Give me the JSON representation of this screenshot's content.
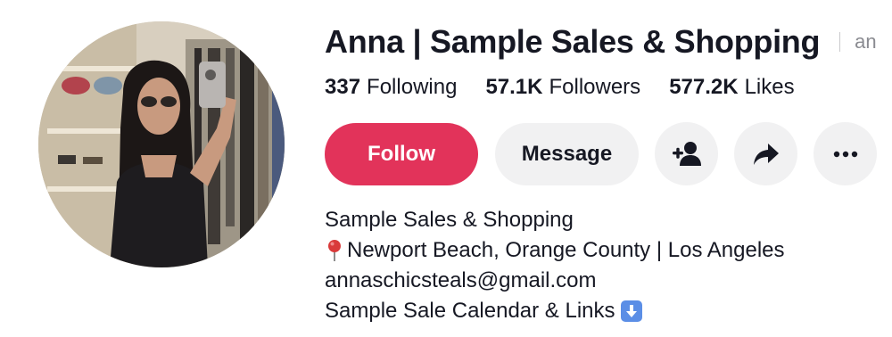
{
  "profile": {
    "display_name": "Anna | Sample Sales & Shopping",
    "username_partial": "an",
    "avatar_icon": "profile-photo"
  },
  "stats": [
    {
      "value": "337",
      "label": "Following"
    },
    {
      "value": "57.1K",
      "label": "Followers"
    },
    {
      "value": "577.2K",
      "label": "Likes"
    }
  ],
  "actions": {
    "follow_label": "Follow",
    "message_label": "Message",
    "add_friend_icon": "add-user-icon",
    "share_icon": "share-icon",
    "more_icon": "more-icon"
  },
  "bio": {
    "line1": "Sample Sales & Shopping",
    "line2": "Newport Beach, Orange County | Los Angeles",
    "line2_icon": "pin-icon",
    "line3": "annaschicsteals@gmail.com",
    "line4": "Sample Sale Calendar & Links",
    "line4_icon": "down-arrow-icon"
  },
  "colors": {
    "follow": "#e2335a",
    "secondary_button": "#f1f1f2",
    "text": "#161823",
    "muted": "#8a8b91"
  }
}
